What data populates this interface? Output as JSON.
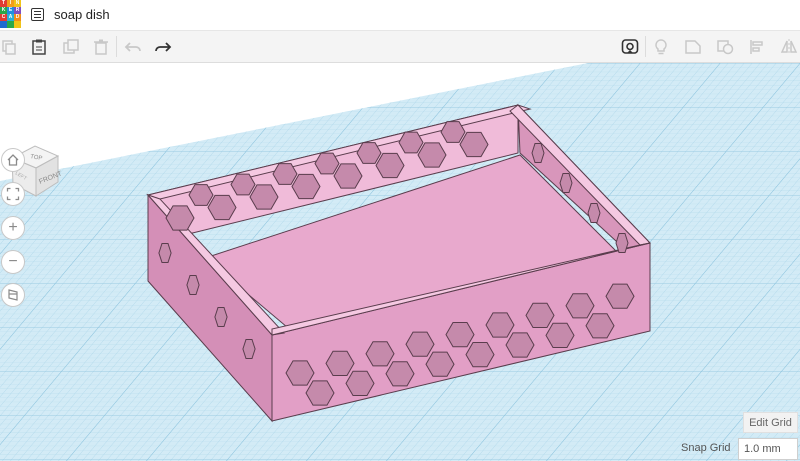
{
  "app": {
    "logo_letters": [
      "T",
      "I",
      "N",
      "K",
      "E",
      "R",
      "C",
      "A",
      "D"
    ],
    "logo_colors": [
      "#e13b32",
      "#f39d1b",
      "#f0c419",
      "#2aa84a",
      "#1f8ee0",
      "#7e4fc2",
      "#e13b32",
      "#27b0d8",
      "#f08c1b",
      "#1f6ad0",
      "#2aa84a",
      "#f0c419"
    ],
    "design_name": "soap dish"
  },
  "toolbar": {
    "icons": [
      "copy-icon",
      "paste-icon",
      "duplicate-icon",
      "delete-icon",
      "undo-icon",
      "redo-icon",
      "camera-view-icon",
      "bulb-icon",
      "note-icon",
      "group-icon",
      "align-icon",
      "mirror-icon"
    ]
  },
  "viewcube": {
    "top_label": "TOP",
    "front_label": "FRONT",
    "left_label": "LEFT"
  },
  "nav": {
    "zoom_in": "+",
    "zoom_out": "−"
  },
  "grid": {
    "edit_label": "Edit Grid",
    "snap_label": "Snap Grid",
    "snap_value": "1.0 mm"
  },
  "colors": {
    "workplane": "#cfe8f4",
    "grid_line": "#9ccde4",
    "object_fill": "#e8a9cd",
    "object_outline": "#5a3d4d"
  }
}
